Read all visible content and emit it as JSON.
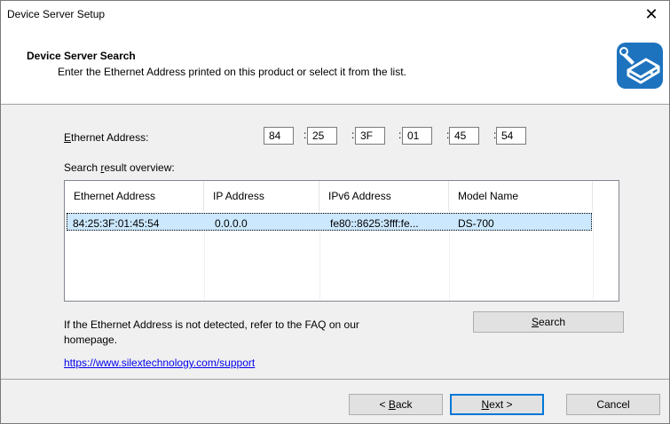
{
  "window": {
    "title": "Device Server Setup",
    "close_glyph": "✕"
  },
  "header": {
    "title": "Device Server Search",
    "subtitle": "Enter the Ethernet Address printed on this product or select it from the list.",
    "icon": "device-server-wrench-icon"
  },
  "ethernet": {
    "label_prefix": "",
    "label_mnemonic": "E",
    "label_rest": "thernet Address:",
    "octets": [
      "84",
      "25",
      "3F",
      "01",
      "45",
      "54"
    ],
    "separator": ":"
  },
  "search_result": {
    "label_prefix": "Search ",
    "label_mnemonic": "r",
    "label_rest": "esult overview:",
    "columns": [
      "Ethernet Address",
      "IP Address",
      "IPv6 Address",
      "Model Name"
    ],
    "rows": [
      [
        "84:25:3F:01:45:54",
        "0.0.0.0",
        "fe80::8625:3fff:fe...",
        "DS-700"
      ]
    ]
  },
  "faq": {
    "text_line1": "If the Ethernet Address is not detected, refer to the FAQ on our",
    "text_line2": "homepage.",
    "link": "https://www.silextechnology.com/support"
  },
  "buttons": {
    "search_mnemonic": "S",
    "search_rest": "earch",
    "back_prefix": "< ",
    "back_mnemonic": "B",
    "back_rest": "ack",
    "next_mnemonic": "N",
    "next_rest": "ext >",
    "cancel": "Cancel"
  },
  "colors": {
    "accent": "#0078d7",
    "selection": "#cce8ff",
    "icon_blue": "#1e73be",
    "link": "#0000ee"
  }
}
